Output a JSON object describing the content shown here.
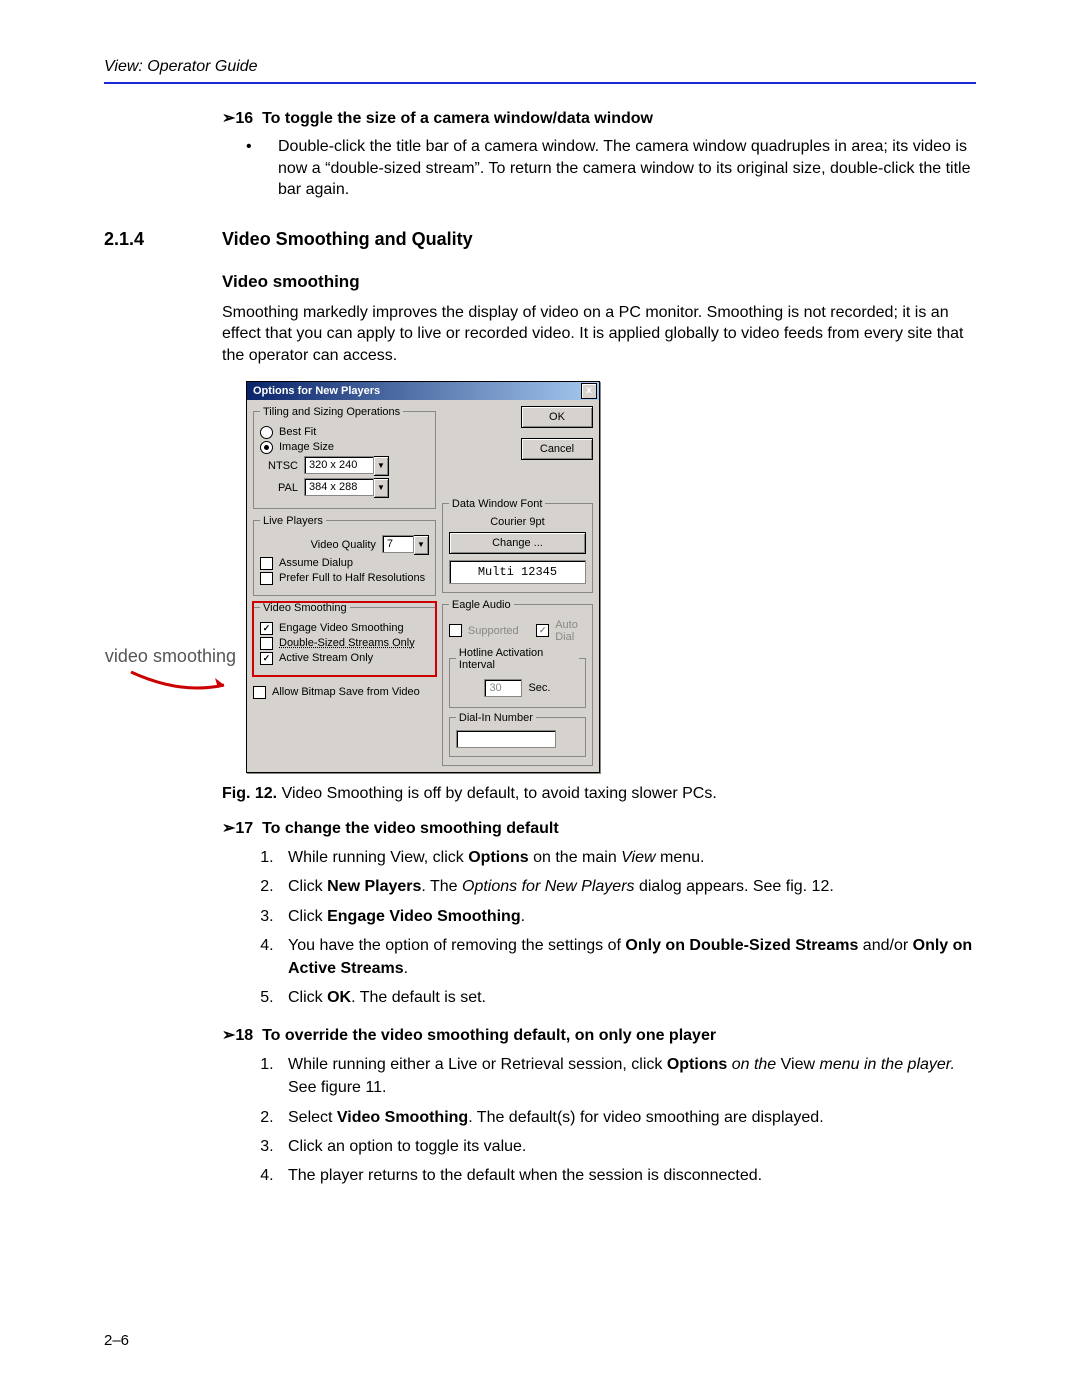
{
  "header": {
    "running": "View: Operator Guide"
  },
  "proc16": {
    "num": "16",
    "title": "To toggle the size of a camera window/data window",
    "bullet": "Double-click the title bar of a camera window. The camera window quadruples in area; its video is now a “double-sized stream”. To return the camera window to its original size, double-click the title bar again."
  },
  "section": {
    "num": "2.1.4",
    "title": "Video Smoothing and Quality"
  },
  "sub": {
    "h3": "Video smoothing",
    "para": "Smoothing markedly improves the display of video on a PC monitor. Smoothing is not recorded; it is an effect that you can apply to live or recorded video. It is applied globally to video feeds from every site that the operator can access."
  },
  "callout": "video smoothing",
  "dialog": {
    "title": "Options for New Players",
    "close": "x",
    "ok": "OK",
    "cancel": "Cancel",
    "tiling": {
      "legend": "Tiling and Sizing Operations",
      "bestFit": "Best Fit",
      "imageSize": "Image Size",
      "ntscLabel": "NTSC",
      "ntscValue": "320 x 240",
      "palLabel": "PAL",
      "palValue": "384 x 288"
    },
    "live": {
      "legend": "Live Players",
      "vqLabel": "Video Quality",
      "vqValue": "7",
      "assume": "Assume Dialup",
      "prefer": "Prefer Full to Half Resolutions"
    },
    "smoothing": {
      "legend": "Video Smoothing",
      "engage": "Engage Video Smoothing",
      "double": "Double-Sized Streams Only",
      "active": "Active Stream Only"
    },
    "allowBitmap": "Allow Bitmap Save from Video",
    "font": {
      "legend": "Data Window Font",
      "current": "Courier 9pt",
      "change": "Change ...",
      "preview": "Multi 12345"
    },
    "eagle": {
      "legend": "Eagle Audio",
      "supported": "Supported",
      "autodial": "Auto Dial"
    },
    "hotline": {
      "legend": "Hotline Activation Interval",
      "value": "30",
      "unit": "Sec."
    },
    "dialin": {
      "legend": "Dial-In Number",
      "value": ""
    }
  },
  "caption": {
    "prefix": "Fig. 12.",
    "text": " Video Smoothing is off by default, to avoid taxing slower PCs."
  },
  "proc17": {
    "num": "17",
    "title": "To change the video smoothing default",
    "s1a": "While running View, click ",
    "s1b": "Options",
    "s1c": " on the main ",
    "s1d": "View",
    "s1e": " menu.",
    "s2a": "Click ",
    "s2b": "New Players",
    "s2c": ". The ",
    "s2d": "Options for New Players",
    "s2e": " dialog appears. See fig. 12.",
    "s3a": "Click ",
    "s3b": "Engage Video Smoothing",
    "s3c": ".",
    "s4a": "You have the option of removing the settings of ",
    "s4b": "Only on Double-Sized Streams",
    "s4c": " and/or ",
    "s4d": "Only on Active Streams",
    "s4e": ".",
    "s5a": "Click ",
    "s5b": "OK",
    "s5c": ". The default is set."
  },
  "proc18": {
    "num": "18",
    "title": "To override the video smoothing default, on only one player",
    "s1a": "While running either a Live or Retrieval session, click ",
    "s1b": "Options",
    "s1c": " on the ",
    "s1d": "View ",
    "s1e": "menu in the player.",
    "s1f": " See figure 11.",
    "s2a": "Select ",
    "s2b": "Video Smoothing",
    "s2c": ". The default(s) for video smoothing are displayed.",
    "s3": "Click an option to toggle its value.",
    "s4": "The player returns to the default when the session is disconnected."
  },
  "pageNum": "2–6"
}
